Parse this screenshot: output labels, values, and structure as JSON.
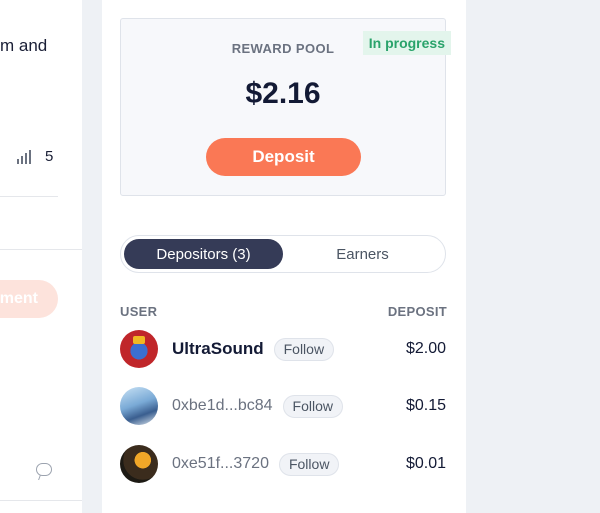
{
  "left_panel": {
    "text_fragment": "m and",
    "stat_value": "5",
    "button_label_fragment": "ment"
  },
  "reward_pool": {
    "label": "REWARD POOL",
    "status": "In progress",
    "amount": "$2.16",
    "deposit_label": "Deposit"
  },
  "tabs": [
    {
      "label": "Depositors (3)",
      "active": true
    },
    {
      "label": "Earners",
      "active": false
    }
  ],
  "table": {
    "headers": {
      "user": "USER",
      "deposit": "DEPOSIT"
    },
    "rows": [
      {
        "user": "UltraSound",
        "follow": "Follow",
        "deposit": "$2.00"
      },
      {
        "user": "0xbe1d...bc84",
        "follow": "Follow",
        "deposit": "$0.15"
      },
      {
        "user": "0xe51f...3720",
        "follow": "Follow",
        "deposit": "$0.01"
      }
    ]
  },
  "colors": {
    "accent": "#fa7855",
    "tab_active": "#353b57",
    "status_green": "#2aa36b"
  }
}
